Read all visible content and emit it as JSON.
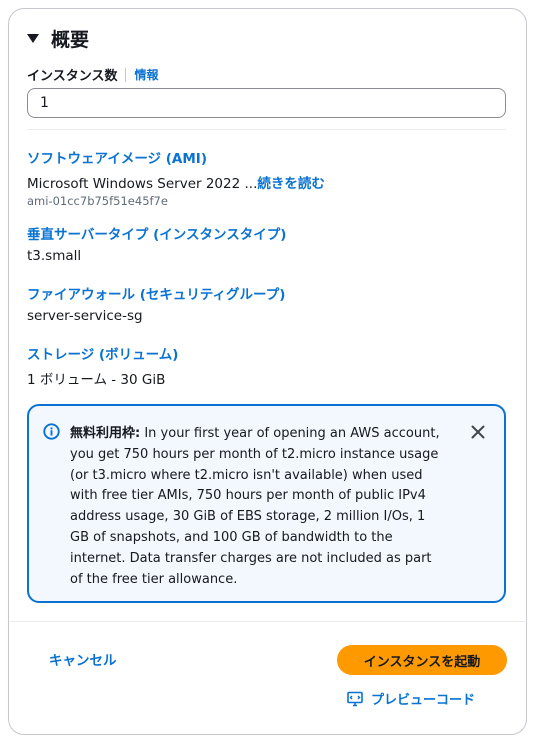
{
  "summary": {
    "title": "概要",
    "instance_count": {
      "label": "インスタンス数",
      "info": "情報",
      "value": "1"
    }
  },
  "sections": {
    "ami": {
      "title": "ソフトウェアイメージ (AMI)",
      "value": "Microsoft Windows Server 2022 ...",
      "more": "続きを読む",
      "id": "ami-01cc7b75f51e45f7e"
    },
    "instance_type": {
      "title": "垂直サーバータイプ (インスタンスタイプ)",
      "value": "t3.small"
    },
    "firewall": {
      "title": "ファイアウォール (セキュリティグループ)",
      "value": "server-service-sg"
    },
    "storage": {
      "title": "ストレージ (ボリューム)",
      "value": "1 ボリューム - 30 GiB"
    }
  },
  "alert": {
    "icon": "info-icon",
    "heading": "無料利用枠:",
    "body": " In your first year of opening an AWS account, you get 750 hours per month of t2.micro instance usage (or t3.micro where t2.micro isn't available) when used with free tier AMIs, 750 hours per month of public IPv4 address usage, 30 GiB of EBS storage, 2 million I/Os, 1 GB of snapshots, and 100 GB of bandwidth to the internet. Data transfer charges are not included as part of the free tier allowance.",
    "close_icon": "close-icon"
  },
  "actions": {
    "cancel": "キャンセル",
    "launch": "インスタンスを起動",
    "preview": "プレビューコード"
  },
  "colors": {
    "link": "#0972d3",
    "primary_button": "#ff9900",
    "alert_border": "#0972d3",
    "alert_bg": "#f2f8fd"
  }
}
